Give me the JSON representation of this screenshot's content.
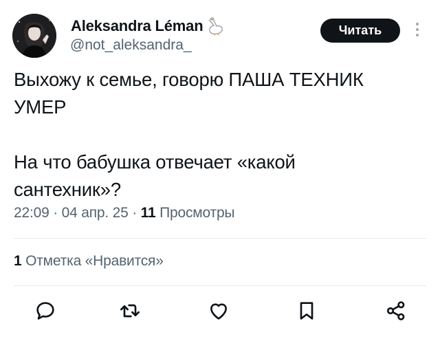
{
  "author": {
    "display_name": "Aleksandra Léman",
    "handle": "@not_aleksandra_",
    "badge_icon": "goose-emoji"
  },
  "header": {
    "follow_label": "Читать",
    "more_icon": "more-vertical-icon"
  },
  "tweet": {
    "text": "Выхожу к семье, говорю ПАША ТЕХНИК\nУМЕР\n\nНа что бабушка отвечает «какой\nсантехник»?"
  },
  "meta": {
    "time": "22:09",
    "date": "04 апр. 25",
    "separator": "·",
    "views_count": "11",
    "views_label": "Просмотры"
  },
  "engagement": {
    "likes_count": "1",
    "likes_label": "Отметка «Нравится»"
  },
  "actions": [
    "reply-icon",
    "retweet-icon",
    "like-icon",
    "bookmark-icon",
    "share-icon"
  ],
  "colors": {
    "text": "#0f1419",
    "secondary": "#536471",
    "divider": "#e6e9ec",
    "button_bg": "#0f1419",
    "button_text": "#ffffff"
  }
}
